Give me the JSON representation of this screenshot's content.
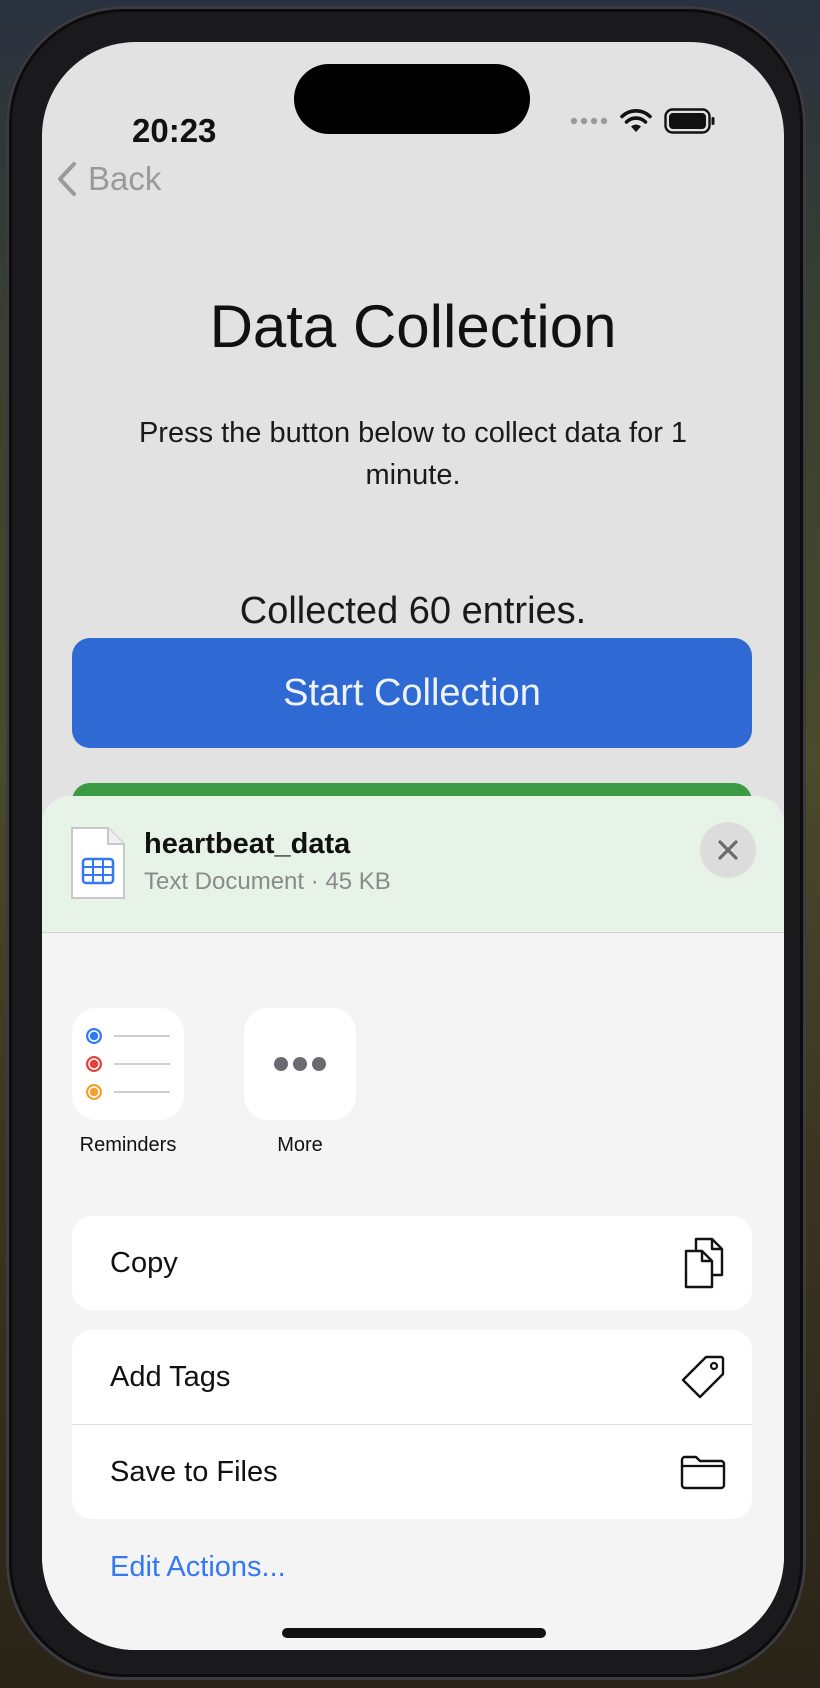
{
  "status_bar": {
    "time": "20:23"
  },
  "nav": {
    "back_label": "Back"
  },
  "page": {
    "title": "Data Collection",
    "instructions": "Press the button below to collect data for 1 minute.",
    "count_text": "Collected 60 entries.",
    "start_button": "Start Collection"
  },
  "share_sheet": {
    "file_name": "heartbeat_data",
    "file_meta": "Text Document · 45 KB",
    "apps": [
      {
        "label": "Reminders",
        "icon": "reminders-icon"
      },
      {
        "label": "More",
        "icon": "more-icon"
      }
    ],
    "actions": {
      "copy": "Copy",
      "add_tags": "Add Tags",
      "save_to_files": "Save to Files"
    },
    "edit_actions": "Edit Actions..."
  },
  "colors": {
    "accent": "#2f6ad4",
    "link": "#3478f6",
    "green": "#3b9a44"
  }
}
